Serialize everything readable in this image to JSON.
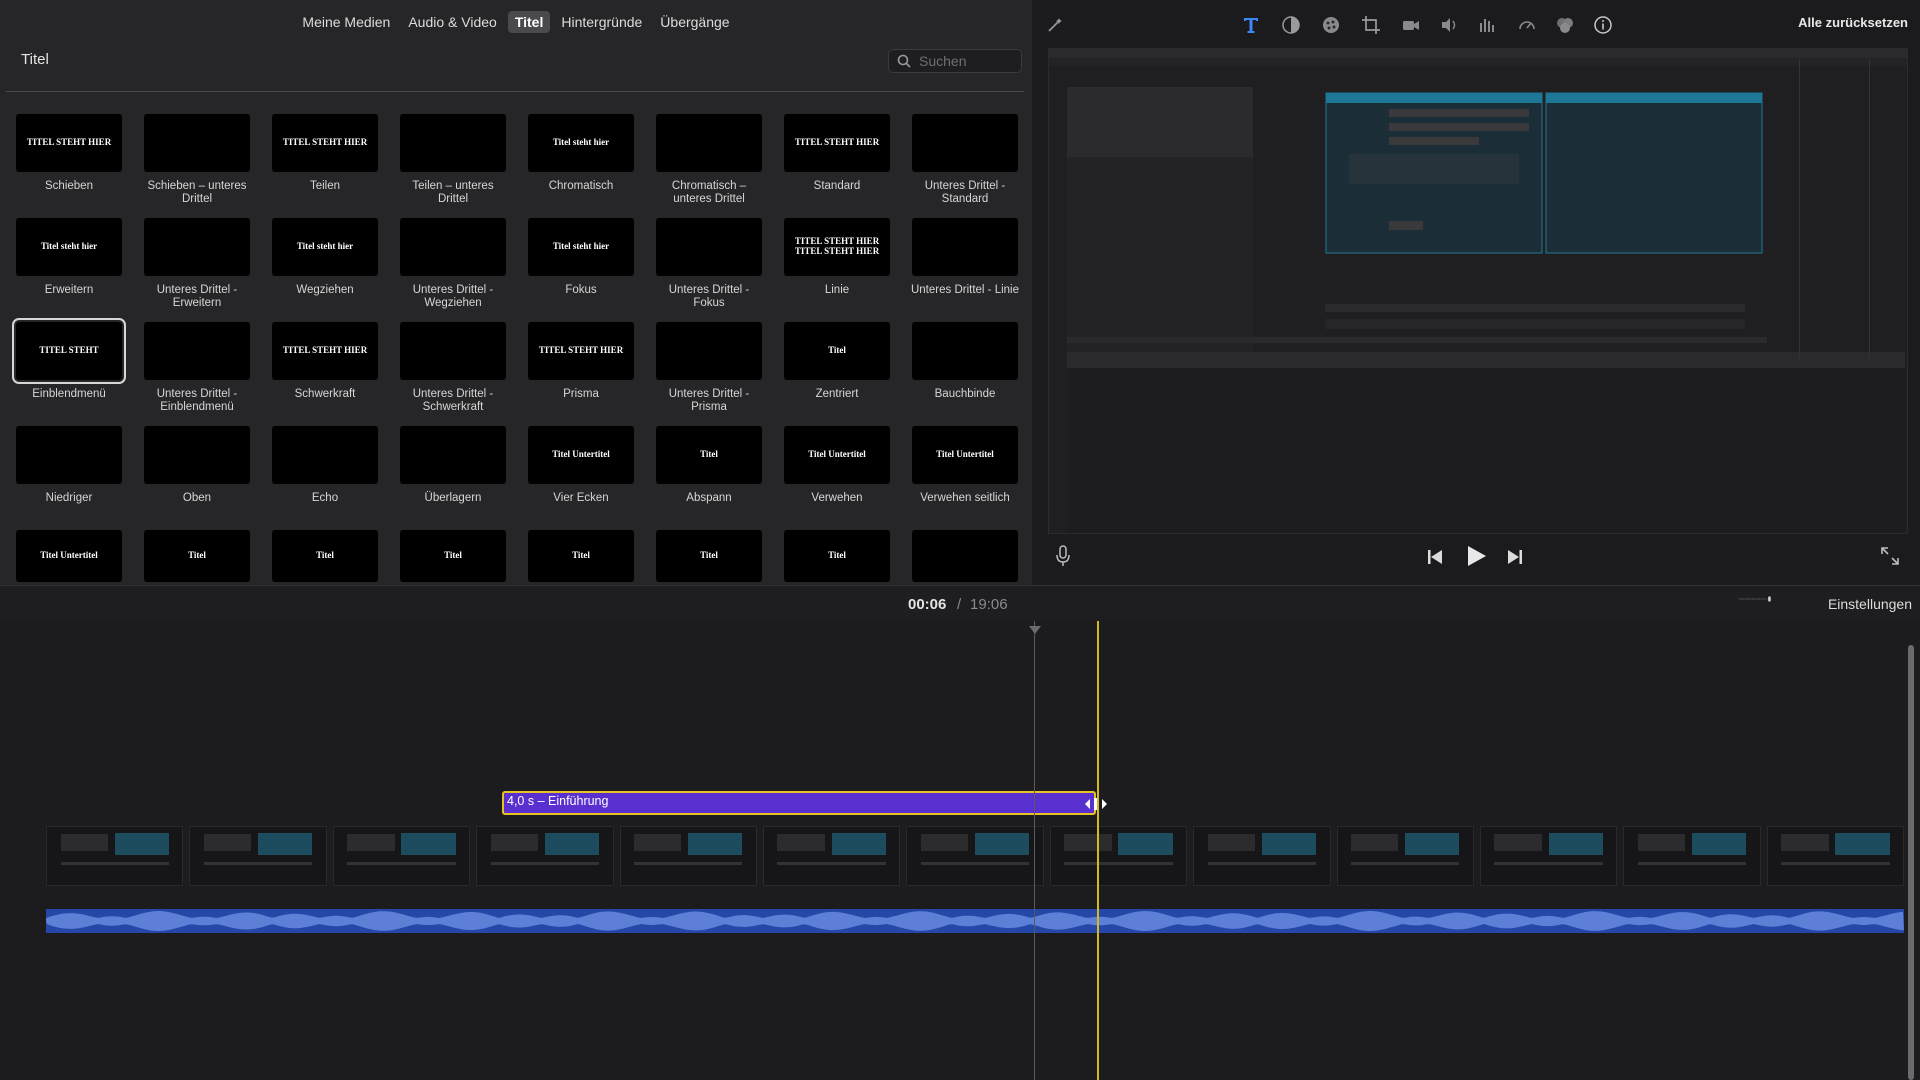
{
  "browser": {
    "tabs": [
      {
        "label": "Meine Medien"
      },
      {
        "label": "Audio & Video"
      },
      {
        "label": "Titel"
      },
      {
        "label": "Hintergründe"
      },
      {
        "label": "Übergänge"
      }
    ],
    "active_tab": "Titel",
    "title": "Titel",
    "search_placeholder": "Suchen",
    "tiles": [
      {
        "label": "Schieben",
        "thumb": "TITEL STEHT HIER"
      },
      {
        "label": "Schieben – unteres Drittel",
        "thumb": ""
      },
      {
        "label": "Teilen",
        "thumb": "TITEL STEHT HIER"
      },
      {
        "label": "Teilen – unteres Drittel",
        "thumb": ""
      },
      {
        "label": "Chromatisch",
        "thumb": "Titel steht hier"
      },
      {
        "label": "Chromatisch – unteres Drittel",
        "thumb": ""
      },
      {
        "label": "Standard",
        "thumb": "TITEL STEHT HIER"
      },
      {
        "label": "Unteres Drittel - Standard",
        "thumb": ""
      },
      {
        "label": "Erweitern",
        "thumb": "Titel steht hier"
      },
      {
        "label": "Unteres Drittel - Erweitern",
        "thumb": ""
      },
      {
        "label": "Wegziehen",
        "thumb": "Titel steht hier"
      },
      {
        "label": "Unteres Drittel - Wegziehen",
        "thumb": ""
      },
      {
        "label": "Fokus",
        "thumb": "Titel steht hier"
      },
      {
        "label": "Unteres Drittel - Fokus",
        "thumb": ""
      },
      {
        "label": "Linie",
        "thumb": "TITEL STEHT HIER TITEL STEHT HIER"
      },
      {
        "label": "Unteres Drittel - Linie",
        "thumb": ""
      },
      {
        "label": "Einblendmenü",
        "thumb": "TITEL STEHT"
      },
      {
        "label": "Unteres Drittel - Einblendmenü",
        "thumb": ""
      },
      {
        "label": "Schwerkraft",
        "thumb": "TITEL STEHT HIER"
      },
      {
        "label": "Unteres Drittel - Schwerkraft",
        "thumb": ""
      },
      {
        "label": "Prisma",
        "thumb": "TITEL STEHT HIER"
      },
      {
        "label": "Unteres Drittel - Prisma",
        "thumb": ""
      },
      {
        "label": "Zentriert",
        "thumb": "Titel"
      },
      {
        "label": "Bauchbinde",
        "thumb": ""
      },
      {
        "label": "Niedriger",
        "thumb": ""
      },
      {
        "label": "Oben",
        "thumb": ""
      },
      {
        "label": "Echo",
        "thumb": ""
      },
      {
        "label": "Überlagern",
        "thumb": ""
      },
      {
        "label": "Vier Ecken",
        "thumb": "Titel Untertitel"
      },
      {
        "label": "Abspann",
        "thumb": "Titel"
      },
      {
        "label": "Verwehen",
        "thumb": "Titel Untertitel"
      },
      {
        "label": "Verwehen seitlich",
        "thumb": "Titel Untertitel"
      },
      {
        "label": "",
        "thumb": "Titel Untertitel"
      },
      {
        "label": "",
        "thumb": "Titel"
      },
      {
        "label": "",
        "thumb": "Titel"
      },
      {
        "label": "",
        "thumb": "Titel"
      },
      {
        "label": "",
        "thumb": "Titel"
      },
      {
        "label": "",
        "thumb": "Titel"
      },
      {
        "label": "",
        "thumb": "Titel"
      },
      {
        "label": "",
        "thumb": ""
      }
    ],
    "selected_tile": "Einblendmenü"
  },
  "viewer": {
    "reset_all": "Alle zurücksetzen",
    "tools": [
      "magic-wand-icon",
      "text-icon",
      "color-balance-icon",
      "color-wheel-icon",
      "crop-icon",
      "camera-stabilize-icon",
      "volume-icon",
      "equalizer-icon",
      "speed-icon",
      "filter-icon",
      "info-icon"
    ]
  },
  "timeline": {
    "current_time": "00:06",
    "separator": "/",
    "total_time": "19:06",
    "settings_label": "Einstellungen",
    "title_clip_label": "4,0 s – Einführung"
  },
  "colors": {
    "accent_purple": "#5a2fcf",
    "clip_border": "#e7c224",
    "audio_blue": "#2547a8"
  }
}
